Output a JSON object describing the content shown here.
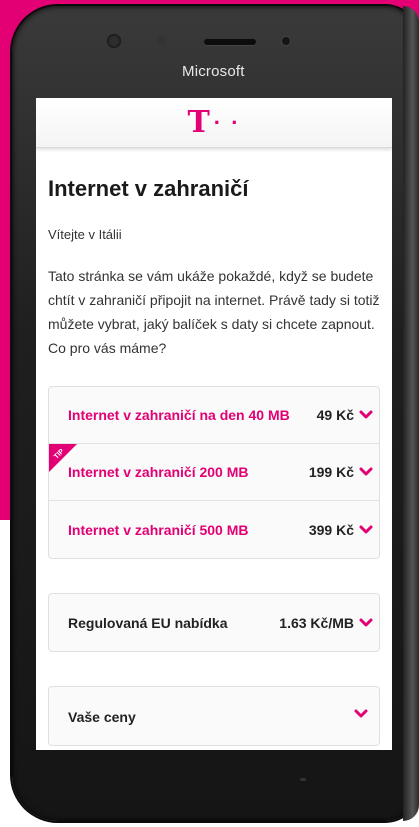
{
  "phone": {
    "brand": "Microsoft"
  },
  "header": {
    "logo_letter": "T",
    "logo_dots": "· ·",
    "brand_color": "#e20074"
  },
  "page": {
    "title": "Internet v zahraničí",
    "greeting": "Vítejte v Itálii",
    "intro": "Tato stránka se vám ukáže pokaždé, když se budete chtít v zahraničí připojit na internet. Právě tady si totiž můžete vybrat, jaký balíček s daty si chcete zapnout. Co pro vás máme?"
  },
  "offers": [
    {
      "name": "Internet v zahraničí na den 40 MB",
      "price": "49 Kč"
    },
    {
      "name": "Internet v zahraničí 200 MB",
      "price": "199 Kč",
      "badge": "TIP"
    },
    {
      "name": "Internet v zahraničí 500 MB",
      "price": "399 Kč"
    }
  ],
  "eu_offer": {
    "name": "Regulovaná EU nabídka",
    "price": "1.63 Kč/MB"
  },
  "next_section": {
    "label": "Vaše ceny"
  },
  "icons": {
    "expand": "chevron-down-icon",
    "badge": "tip-ribbon-icon"
  }
}
